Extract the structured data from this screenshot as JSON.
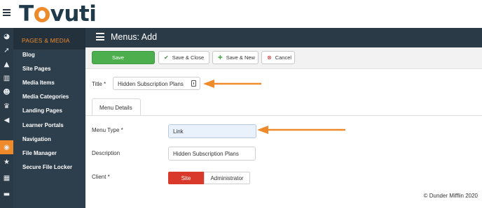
{
  "app": {
    "logo_text_1": "T",
    "logo_text_2": "vuti"
  },
  "rail": {
    "icons": [
      "dashboard-icon",
      "rocket-icon",
      "graduation-cap-icon",
      "bar-chart-icon",
      "users-icon",
      "trophy-icon",
      "bullhorn-icon",
      "rss-icon",
      "star-icon",
      "table-icon",
      "credit-card-icon"
    ],
    "active_index": 7,
    "glyphs": [
      "◕",
      "➚",
      "▲",
      "▥",
      "☻",
      "♛",
      "◀",
      "◉",
      "★",
      "▦",
      "▬"
    ]
  },
  "sidebar": {
    "header": "PAGES & MEDIA",
    "items": [
      {
        "label": "Blog"
      },
      {
        "label": "Site Pages"
      },
      {
        "label": "Media Items"
      },
      {
        "label": "Media Categories"
      },
      {
        "label": "Landing Pages"
      },
      {
        "label": "Learner Portals"
      },
      {
        "label": "Navigation"
      },
      {
        "label": "File Manager"
      },
      {
        "label": "Secure File Locker"
      }
    ]
  },
  "header": {
    "title": "Menus: Add"
  },
  "toolbar": {
    "save": "Save",
    "save_close": "Save & Close",
    "save_new": "Save & New",
    "cancel": "Cancel"
  },
  "form": {
    "title_label": "Title *",
    "title_value": "Hidden Subscription Plans",
    "tab_label": "Menu Details",
    "menu_type_label": "Menu Type *",
    "menu_type_value": "Link",
    "description_label": "Description",
    "description_value": "Hidden Subscription Plans",
    "client_label": "Client *",
    "client_options": [
      "Site",
      "Administrator"
    ],
    "client_selected": "Site"
  },
  "footer": {
    "copyright": "© Dunder Mifflin 2020"
  },
  "colors": {
    "accent_orange": "#ef8a2a",
    "sidebar_dark": "#2d3e4c",
    "save_green": "#4cae4c",
    "site_red": "#d9392b"
  }
}
